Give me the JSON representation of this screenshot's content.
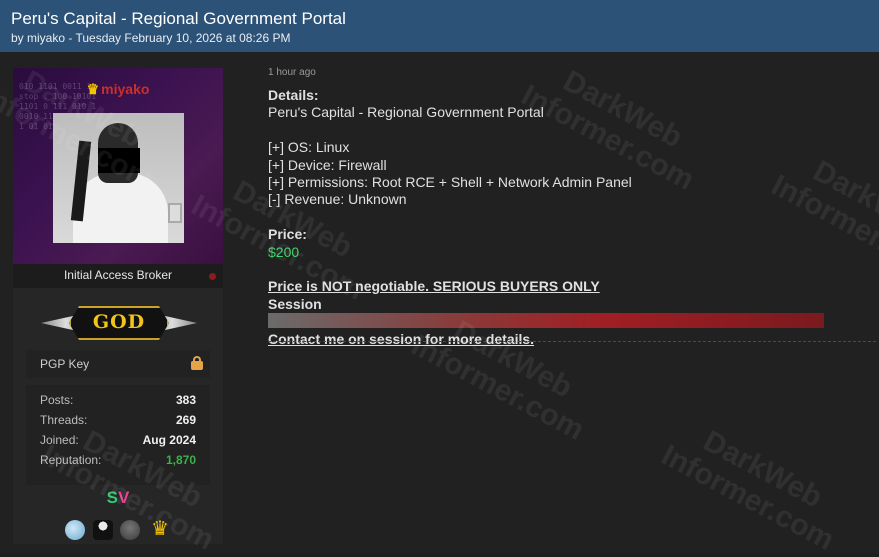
{
  "header": {
    "title": "Peru's Capital - Regional Government Portal",
    "byline": "by miyako - Tuesday February 10, 2026 at 08:26 PM"
  },
  "profile": {
    "username": "miyako",
    "role": "Initial Access Broker",
    "rank_badge": "GOD",
    "pgp_label": "PGP Key",
    "stats": [
      {
        "label": "Posts:",
        "value": "383"
      },
      {
        "label": "Threads:",
        "value": "269"
      },
      {
        "label": "Joined:",
        "value": "Aug 2024"
      },
      {
        "label": "Reputation:",
        "value": "1,870"
      }
    ],
    "badge_s": "S",
    "badge_v": "V",
    "awards": [
      "globe-award-icon",
      "suit-award-icon",
      "helmet-award-icon",
      "crown-award-icon"
    ],
    "colors": {
      "username": "#c9302c",
      "reputation": "#3bb14a",
      "online_dot": "#8a1d1d",
      "header": "#2c5277"
    }
  },
  "post": {
    "time": "1 hour ago",
    "details_label": "Details:",
    "details_title": "Peru's Capital - Regional Government Portal",
    "os": "[+] OS: Linux",
    "device": "[+] Device: Firewall",
    "permissions": "[+] Permissions: Root RCE + Shell + Network Admin Panel",
    "revenue": "[-] Revenue: Unknown",
    "price_label": "Price:",
    "price": "$200",
    "notice": "Price is NOT negotiable. SERIOUS BUYERS ONLY",
    "session_label": "Session",
    "contact": "Contact me on session for more details."
  },
  "watermark": {
    "line1": "DarkWeb",
    "line2": "Informer.com"
  }
}
